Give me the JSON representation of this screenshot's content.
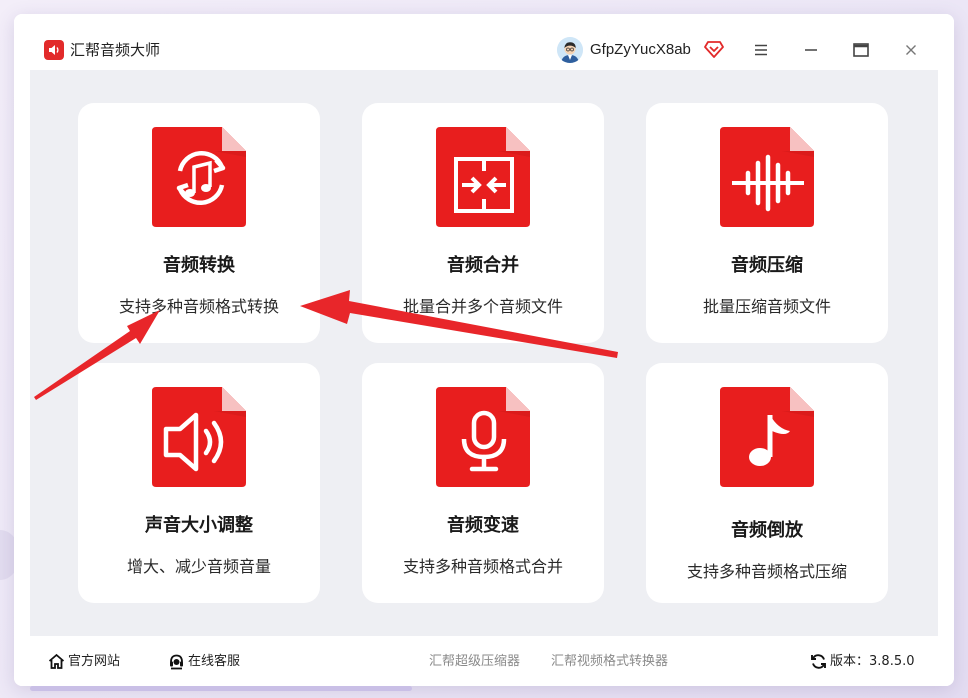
{
  "app": {
    "title": "汇帮音频大师",
    "username": "GfpZyYucX8ab"
  },
  "colors": {
    "brand_red": "#e22a2a",
    "card_bg": "#ffffff",
    "panel_bg": "#eeeff3",
    "arrow_red": "#e8262a"
  },
  "cards": [
    {
      "title": "音频转换",
      "desc": "支持多种音频格式转换",
      "icon": "music-convert-icon"
    },
    {
      "title": "音频合并",
      "desc": "批量合并多个音频文件",
      "icon": "merge-icon"
    },
    {
      "title": "音频压缩",
      "desc": "批量压缩音频文件",
      "icon": "waveform-icon"
    },
    {
      "title": "声音大小调整",
      "desc": "增大、减少音频音量",
      "icon": "speaker-volume-icon"
    },
    {
      "title": "音频变速",
      "desc": "支持多种音频格式合并",
      "icon": "microphone-icon"
    },
    {
      "title": "音频倒放",
      "desc": "支持多种音频格式压缩",
      "icon": "music-note-icon"
    }
  ],
  "footer": {
    "website": "官方网站",
    "service": "在线客服",
    "link1": "汇帮超级压缩器",
    "link2": "汇帮视频格式转换器",
    "version_label": "版本：",
    "version": "3.8.5.0"
  }
}
